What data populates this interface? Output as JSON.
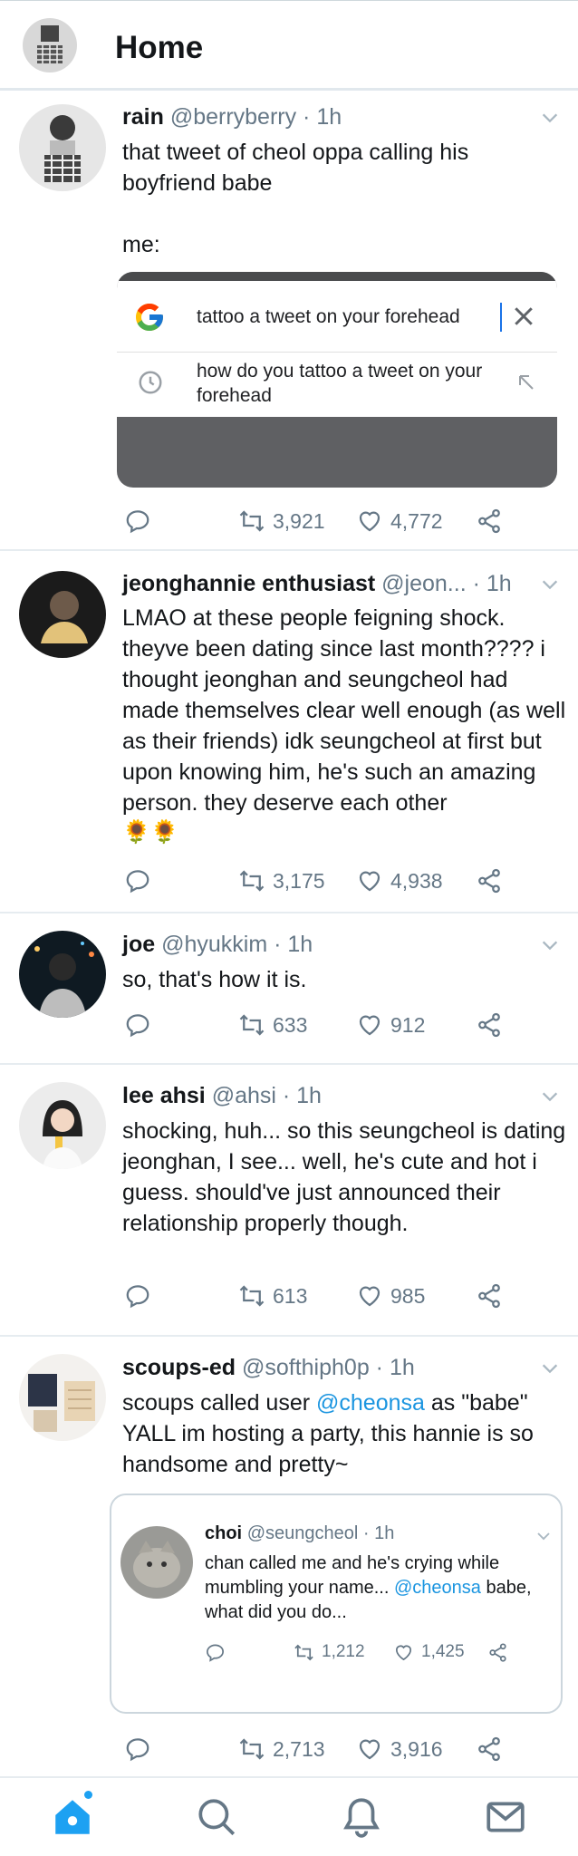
{
  "header": {
    "title": "Home"
  },
  "tweets": [
    {
      "name": "rain",
      "handle": "@berryberry",
      "time": "1h",
      "text": "that tweet of cheol oppa calling his boyfriend babe\n\nme:",
      "embed": {
        "query": "tattoo a tweet on your forehead",
        "suggestion": "how do you tattoo a tweet on your forehead"
      },
      "retweets": "3,921",
      "likes": "4,772"
    },
    {
      "name": "jeonghannie enthusiast",
      "handle": "@jeon...",
      "time": "1h",
      "text": "LMAO at these people feigning shock. theyve been dating since last month???? i thought jeonghan and seungcheol had made themselves clear well enough (as well as their friends) idk seungcheol at first but upon knowing him, he's such an amazing person. they deserve each other",
      "emoji": "🌻🌻",
      "retweets": "3,175",
      "likes": "4,938"
    },
    {
      "name": "joe",
      "handle": "@hyukkim",
      "time": "1h",
      "text": "so, that's how it is.",
      "retweets": "633",
      "likes": "912"
    },
    {
      "name": "lee ahsi",
      "handle": "@ahsi",
      "time": "1h",
      "text": "shocking, huh... so this seungcheol is dating jeonghan, I see... well, he's cute and hot i guess. should've just announced their relationship properly though.",
      "retweets": "613",
      "likes": "985"
    },
    {
      "name": "scoups-ed",
      "handle": "@softhiph0p",
      "time": "1h",
      "text_before": "scoups called user ",
      "mention": "@cheonsa",
      "text_after": " as \"babe\" YALL im hosting a party, this hannie is so handsome and pretty~",
      "quote": {
        "name": "choi",
        "handle": "@seungcheol",
        "time": "1h",
        "text_before": "chan called me and he's crying while mumbling your name... ",
        "mention": "@cheonsa",
        "text_after": " babe, what did you do...",
        "retweets": "1,212",
        "likes": "1,425"
      },
      "retweets": "2,713",
      "likes": "3,916"
    }
  ],
  "icons": {
    "reply": "reply-icon",
    "retweet": "retweet-icon",
    "like": "like-icon",
    "share": "share-icon",
    "home": "home-icon",
    "search": "search-icon",
    "notifications": "bell-icon",
    "messages": "mail-icon"
  },
  "colors": {
    "accent": "#1da1f2",
    "link": "#1b95e0",
    "muted": "#657786"
  }
}
